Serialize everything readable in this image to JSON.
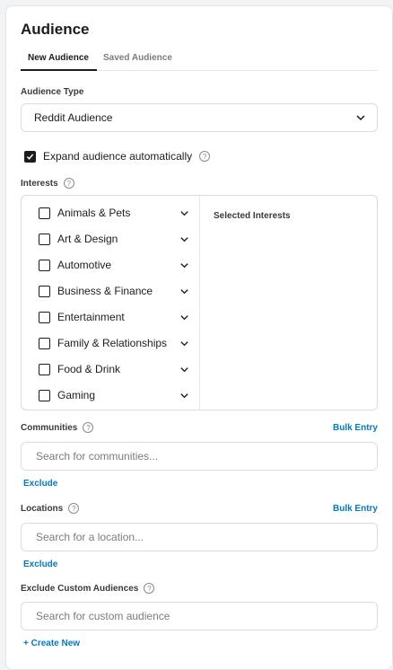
{
  "panel": {
    "title": "Audience",
    "tabs": [
      {
        "label": "New Audience",
        "active": true
      },
      {
        "label": "Saved Audience",
        "active": false
      }
    ]
  },
  "audience_type": {
    "label": "Audience Type",
    "selected": "Reddit Audience"
  },
  "expand": {
    "label": "Expand audience automatically",
    "checked": true
  },
  "interests": {
    "label": "Interests",
    "selected_label": "Selected Interests",
    "items": [
      "Animals & Pets",
      "Art & Design",
      "Automotive",
      "Business & Finance",
      "Entertainment",
      "Family & Relationships",
      "Food & Drink",
      "Gaming"
    ]
  },
  "communities": {
    "label": "Communities",
    "bulk_label": "Bulk Entry",
    "placeholder": "Search for communities...",
    "exclude_label": "Exclude"
  },
  "locations": {
    "label": "Locations",
    "bulk_label": "Bulk Entry",
    "placeholder": "Search for a location...",
    "exclude_label": "Exclude"
  },
  "custom_audiences": {
    "label": "Exclude Custom Audiences",
    "placeholder": "Search for custom audience",
    "create_label": "+ Create New"
  },
  "colors": {
    "accent": "#0079d3",
    "text": "#1c1c1c",
    "border": "#d9dce1"
  },
  "icons": [
    "help-icon",
    "chevron-down-icon",
    "checkmark-icon"
  ]
}
